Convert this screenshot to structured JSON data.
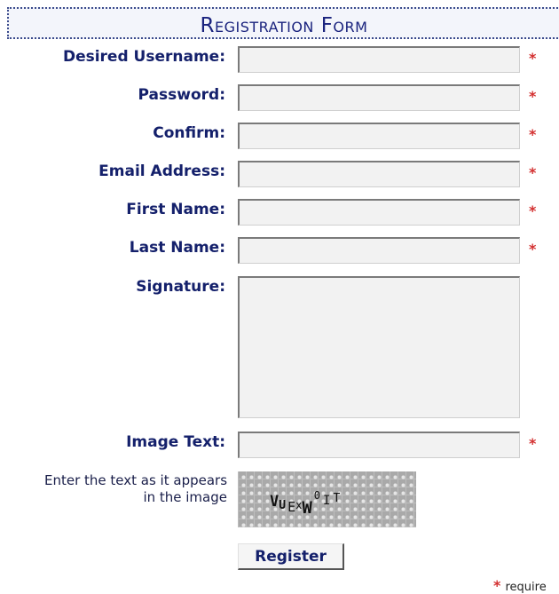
{
  "form": {
    "title": "Registration Form",
    "fields": [
      {
        "label": "Desired Username:",
        "value": "",
        "required": true
      },
      {
        "label": "Password:",
        "value": "",
        "required": true
      },
      {
        "label": "Confirm:",
        "value": "",
        "required": true
      },
      {
        "label": "Email Address:",
        "value": "",
        "required": true
      },
      {
        "label": "First Name:",
        "value": "",
        "required": true
      },
      {
        "label": "Last Name:",
        "value": "",
        "required": true
      }
    ],
    "signature": {
      "label": "Signature:",
      "value": ""
    },
    "image_text": {
      "label": "Image Text:",
      "value": "",
      "required": true
    },
    "captcha_hint": "Enter the text as it appears in the image",
    "captcha_chars": [
      "V",
      "U",
      "E",
      "x",
      "W",
      "0",
      "I",
      "T"
    ],
    "register_label": "Register",
    "required_marker": "*",
    "required_legend": "require"
  },
  "colors": {
    "label": "#14206b",
    "title": "#1a237e",
    "required": "#d32f2f",
    "field_bg": "#f2f2f2"
  }
}
